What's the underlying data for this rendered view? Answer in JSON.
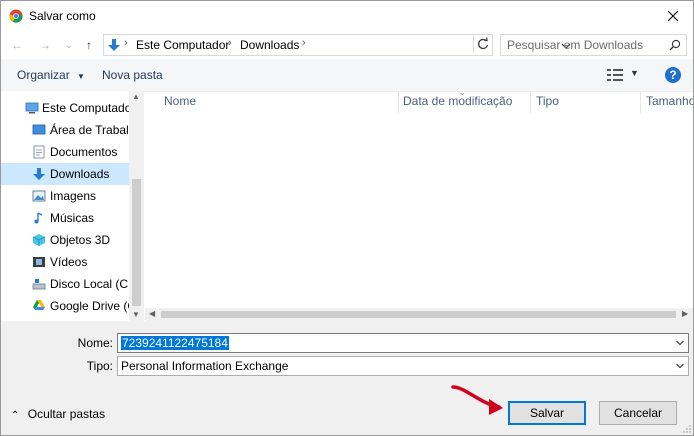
{
  "window": {
    "title": "Salvar como",
    "title_icon": "chrome-icon"
  },
  "address": {
    "location_icon": "downloads-folder-icon",
    "crumbs": [
      "Este Computador",
      "Downloads"
    ],
    "search_placeholder": "Pesquisar em Downloads"
  },
  "toolbar": {
    "organize_label": "Organizar",
    "new_folder_label": "Nova pasta",
    "help_label": "?"
  },
  "sidebar": {
    "items": [
      {
        "label": "Este Computador",
        "icon": "computer-icon",
        "selected": false
      },
      {
        "label": "Área de Trabalho",
        "icon": "desktop-icon",
        "selected": false
      },
      {
        "label": "Documentos",
        "icon": "documents-icon",
        "selected": false
      },
      {
        "label": "Downloads",
        "icon": "downloads-icon",
        "selected": true
      },
      {
        "label": "Imagens",
        "icon": "pictures-icon",
        "selected": false
      },
      {
        "label": "Músicas",
        "icon": "music-icon",
        "selected": false
      },
      {
        "label": "Objetos 3D",
        "icon": "3d-objects-icon",
        "selected": false
      },
      {
        "label": "Vídeos",
        "icon": "videos-icon",
        "selected": false
      },
      {
        "label": "Disco Local (C:)",
        "icon": "local-disk-icon",
        "selected": false
      },
      {
        "label": "Google Drive (G:",
        "icon": "google-drive-icon",
        "selected": false
      }
    ]
  },
  "file_list": {
    "columns": [
      "Nome",
      "Data de modificação",
      "Tipo",
      "Tamanho"
    ]
  },
  "form": {
    "name_label": "Nome:",
    "name_value": "7239241122475184",
    "type_label": "Tipo:",
    "type_value": "Personal Information Exchange"
  },
  "footer": {
    "hide_folders_label": "Ocultar pastas",
    "save_label": "Salvar",
    "cancel_label": "Cancelar"
  },
  "colors": {
    "accent": "#0078d7",
    "selection": "#cce8ff",
    "annotation_arrow": "#d0021b"
  }
}
